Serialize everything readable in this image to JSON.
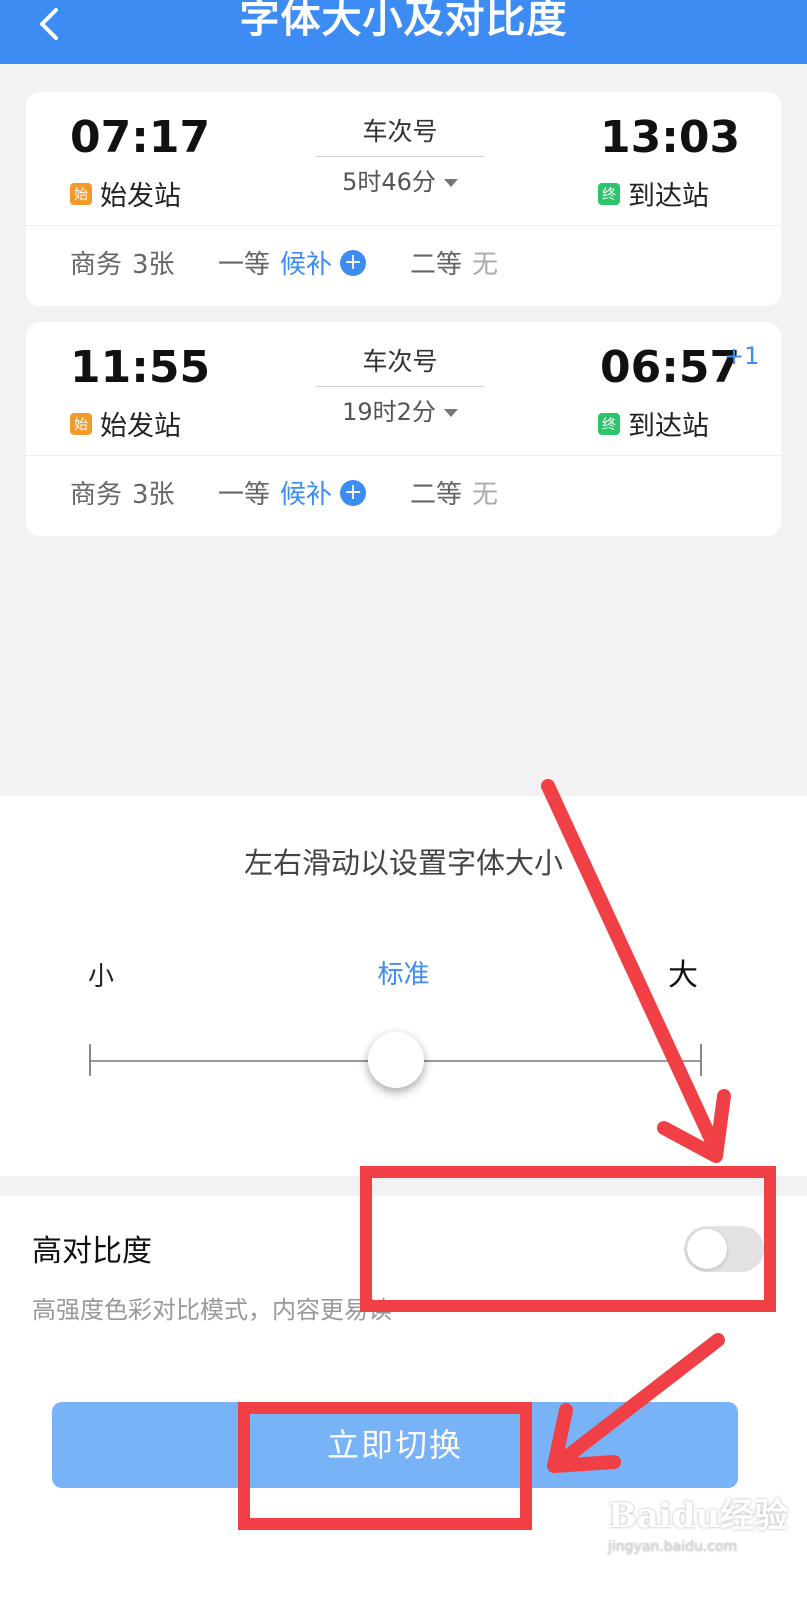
{
  "header": {
    "title": "字体大小及对比度"
  },
  "trains": [
    {
      "dep_time": "07:17",
      "dep_badge": "始",
      "dep_station": "始发站",
      "train_no": "车次号",
      "duration": "5时46分",
      "arr_time": "13:03",
      "arr_badge": "终",
      "arr_station": "到达站",
      "plus_day": "",
      "seats": {
        "business_label": "商务",
        "business_value": "3张",
        "first_label": "一等",
        "first_value": "候补",
        "second_label": "二等",
        "second_value": "无"
      }
    },
    {
      "dep_time": "11:55",
      "dep_badge": "始",
      "dep_station": "始发站",
      "train_no": "车次号",
      "duration": "19时2分",
      "arr_time": "06:57",
      "arr_badge": "终",
      "arr_station": "到达站",
      "plus_day": "+1",
      "seats": {
        "business_label": "商务",
        "business_value": "3张",
        "first_label": "一等",
        "first_value": "候补",
        "second_label": "二等",
        "second_value": "无"
      }
    }
  ],
  "font_size": {
    "hint": "左右滑动以设置字体大小",
    "small_label": "小",
    "standard_label": "标准",
    "large_label": "大",
    "level": 0.5
  },
  "contrast": {
    "title": "高对比度",
    "description": "高强度色彩对比模式，内容更易读",
    "enabled": false
  },
  "actions": {
    "switch_label": "立即切换"
  },
  "watermark": {
    "brand": "Baidu经验",
    "url": "jingyan.baidu.com"
  },
  "colors": {
    "accent": "#3d8cf4",
    "annotation": "#f04045",
    "button": "#78b2f7"
  }
}
